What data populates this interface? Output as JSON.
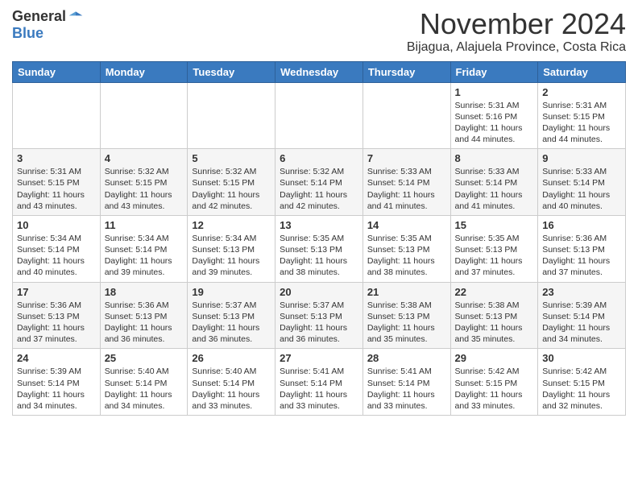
{
  "header": {
    "logo_general": "General",
    "logo_blue": "Blue",
    "month_title": "November 2024",
    "location": "Bijagua, Alajuela Province, Costa Rica"
  },
  "days_of_week": [
    "Sunday",
    "Monday",
    "Tuesday",
    "Wednesday",
    "Thursday",
    "Friday",
    "Saturday"
  ],
  "weeks": [
    [
      {
        "day": "",
        "info": ""
      },
      {
        "day": "",
        "info": ""
      },
      {
        "day": "",
        "info": ""
      },
      {
        "day": "",
        "info": ""
      },
      {
        "day": "",
        "info": ""
      },
      {
        "day": "1",
        "info": "Sunrise: 5:31 AM\nSunset: 5:16 PM\nDaylight: 11 hours\nand 44 minutes."
      },
      {
        "day": "2",
        "info": "Sunrise: 5:31 AM\nSunset: 5:15 PM\nDaylight: 11 hours\nand 44 minutes."
      }
    ],
    [
      {
        "day": "3",
        "info": "Sunrise: 5:31 AM\nSunset: 5:15 PM\nDaylight: 11 hours\nand 43 minutes."
      },
      {
        "day": "4",
        "info": "Sunrise: 5:32 AM\nSunset: 5:15 PM\nDaylight: 11 hours\nand 43 minutes."
      },
      {
        "day": "5",
        "info": "Sunrise: 5:32 AM\nSunset: 5:15 PM\nDaylight: 11 hours\nand 42 minutes."
      },
      {
        "day": "6",
        "info": "Sunrise: 5:32 AM\nSunset: 5:14 PM\nDaylight: 11 hours\nand 42 minutes."
      },
      {
        "day": "7",
        "info": "Sunrise: 5:33 AM\nSunset: 5:14 PM\nDaylight: 11 hours\nand 41 minutes."
      },
      {
        "day": "8",
        "info": "Sunrise: 5:33 AM\nSunset: 5:14 PM\nDaylight: 11 hours\nand 41 minutes."
      },
      {
        "day": "9",
        "info": "Sunrise: 5:33 AM\nSunset: 5:14 PM\nDaylight: 11 hours\nand 40 minutes."
      }
    ],
    [
      {
        "day": "10",
        "info": "Sunrise: 5:34 AM\nSunset: 5:14 PM\nDaylight: 11 hours\nand 40 minutes."
      },
      {
        "day": "11",
        "info": "Sunrise: 5:34 AM\nSunset: 5:14 PM\nDaylight: 11 hours\nand 39 minutes."
      },
      {
        "day": "12",
        "info": "Sunrise: 5:34 AM\nSunset: 5:13 PM\nDaylight: 11 hours\nand 39 minutes."
      },
      {
        "day": "13",
        "info": "Sunrise: 5:35 AM\nSunset: 5:13 PM\nDaylight: 11 hours\nand 38 minutes."
      },
      {
        "day": "14",
        "info": "Sunrise: 5:35 AM\nSunset: 5:13 PM\nDaylight: 11 hours\nand 38 minutes."
      },
      {
        "day": "15",
        "info": "Sunrise: 5:35 AM\nSunset: 5:13 PM\nDaylight: 11 hours\nand 37 minutes."
      },
      {
        "day": "16",
        "info": "Sunrise: 5:36 AM\nSunset: 5:13 PM\nDaylight: 11 hours\nand 37 minutes."
      }
    ],
    [
      {
        "day": "17",
        "info": "Sunrise: 5:36 AM\nSunset: 5:13 PM\nDaylight: 11 hours\nand 37 minutes."
      },
      {
        "day": "18",
        "info": "Sunrise: 5:36 AM\nSunset: 5:13 PM\nDaylight: 11 hours\nand 36 minutes."
      },
      {
        "day": "19",
        "info": "Sunrise: 5:37 AM\nSunset: 5:13 PM\nDaylight: 11 hours\nand 36 minutes."
      },
      {
        "day": "20",
        "info": "Sunrise: 5:37 AM\nSunset: 5:13 PM\nDaylight: 11 hours\nand 36 minutes."
      },
      {
        "day": "21",
        "info": "Sunrise: 5:38 AM\nSunset: 5:13 PM\nDaylight: 11 hours\nand 35 minutes."
      },
      {
        "day": "22",
        "info": "Sunrise: 5:38 AM\nSunset: 5:13 PM\nDaylight: 11 hours\nand 35 minutes."
      },
      {
        "day": "23",
        "info": "Sunrise: 5:39 AM\nSunset: 5:14 PM\nDaylight: 11 hours\nand 34 minutes."
      }
    ],
    [
      {
        "day": "24",
        "info": "Sunrise: 5:39 AM\nSunset: 5:14 PM\nDaylight: 11 hours\nand 34 minutes."
      },
      {
        "day": "25",
        "info": "Sunrise: 5:40 AM\nSunset: 5:14 PM\nDaylight: 11 hours\nand 34 minutes."
      },
      {
        "day": "26",
        "info": "Sunrise: 5:40 AM\nSunset: 5:14 PM\nDaylight: 11 hours\nand 33 minutes."
      },
      {
        "day": "27",
        "info": "Sunrise: 5:41 AM\nSunset: 5:14 PM\nDaylight: 11 hours\nand 33 minutes."
      },
      {
        "day": "28",
        "info": "Sunrise: 5:41 AM\nSunset: 5:14 PM\nDaylight: 11 hours\nand 33 minutes."
      },
      {
        "day": "29",
        "info": "Sunrise: 5:42 AM\nSunset: 5:15 PM\nDaylight: 11 hours\nand 33 minutes."
      },
      {
        "day": "30",
        "info": "Sunrise: 5:42 AM\nSunset: 5:15 PM\nDaylight: 11 hours\nand 32 minutes."
      }
    ]
  ]
}
